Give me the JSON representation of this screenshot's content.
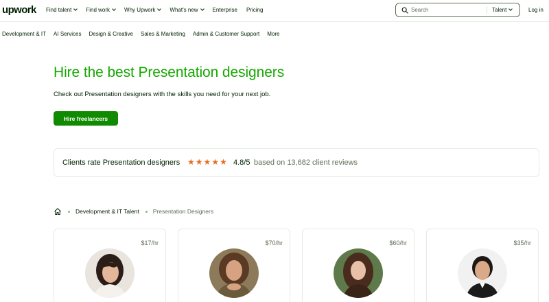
{
  "brand": {
    "logo_text": "upwork",
    "accent": "#14a800",
    "button_color": "#108a00",
    "star_color": "#e86d1f"
  },
  "nav": {
    "items": [
      {
        "label": "Find talent",
        "dropdown": true
      },
      {
        "label": "Find work",
        "dropdown": true
      },
      {
        "label": "Why Upwork",
        "dropdown": true
      },
      {
        "label": "What's new",
        "dropdown": true
      },
      {
        "label": "Enterprise",
        "dropdown": false
      },
      {
        "label": "Pricing",
        "dropdown": false
      }
    ],
    "search_placeholder": "Search",
    "search_scope": "Talent",
    "login": "Log in"
  },
  "categories": [
    "Development & IT",
    "AI Services",
    "Design & Creative",
    "Sales & Marketing",
    "Admin & Customer Support",
    "More"
  ],
  "hero": {
    "title": "Hire the best Presentation designers",
    "subtitle": "Check out Presentation designers with the skills you need for your next job.",
    "cta": "Hire freelancers"
  },
  "rating": {
    "prefix": "Clients rate Presentation designers",
    "stars": 4.8,
    "score": "4.8/5",
    "reviews_text": "based on 13,682 client reviews"
  },
  "breadcrumb": {
    "home_icon": "home-icon",
    "parent": "Development & IT Talent",
    "current": "Presentation Designers"
  },
  "freelancers": [
    {
      "rate": "$17/hr",
      "avatar_icon": "profile-photo"
    },
    {
      "rate": "$70/hr",
      "avatar_icon": "profile-photo"
    },
    {
      "rate": "$60/hr",
      "avatar_icon": "profile-photo"
    },
    {
      "rate": "$35/hr",
      "avatar_icon": "profile-photo"
    }
  ]
}
